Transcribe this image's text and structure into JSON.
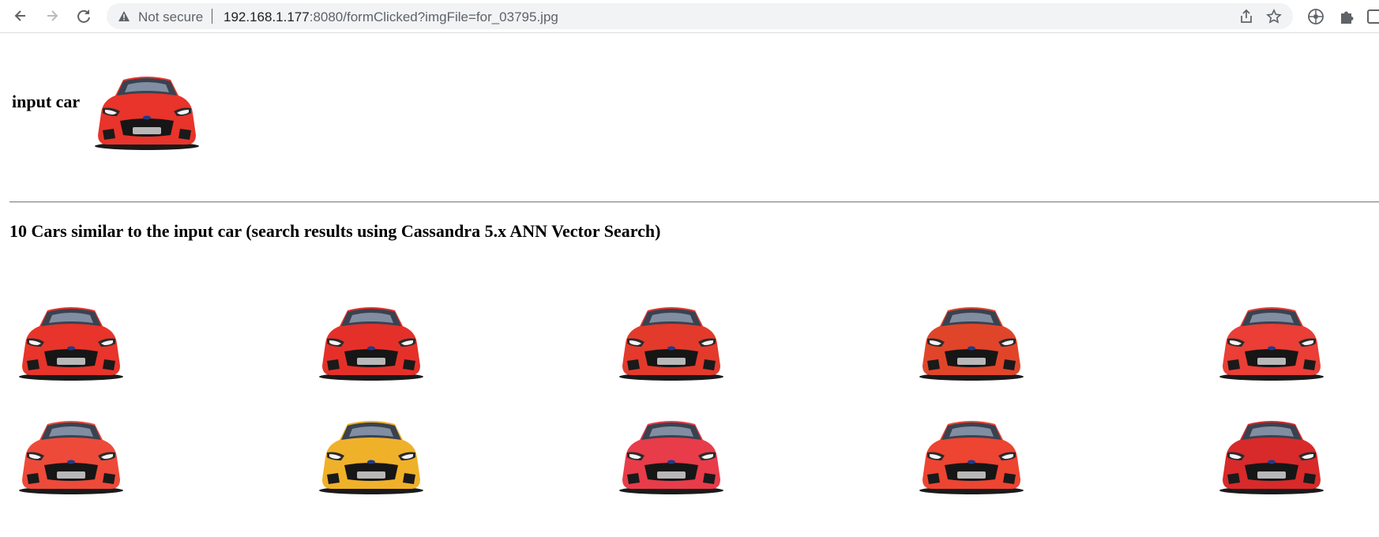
{
  "browser": {
    "security_label": "Not secure",
    "url_host": "192.168.1.177",
    "url_rest": ":8080/formClicked?imgFile=for_03795.jpg",
    "icons": [
      "back-icon",
      "forward-icon",
      "reload-icon",
      "warning-icon",
      "share-icon",
      "star-icon",
      "extension-puzzle-icon",
      "side-panel-icon"
    ]
  },
  "page": {
    "input_label": "input car",
    "results_title": "10 Cars similar to the input car (search results using Cassandra 5.x ANN Vector Search)"
  },
  "colors": {
    "car_red": "#e8342a",
    "car_orange_red": "#e84a2e",
    "car_yellow": "#f0b12a",
    "car_pink_red": "#e83c4a"
  },
  "results": [
    {
      "color": "#e8342a"
    },
    {
      "color": "#e5302a"
    },
    {
      "color": "#e33a2c"
    },
    {
      "color": "#e0452a"
    },
    {
      "color": "#ea3e36"
    },
    {
      "color": "#ee4a3a"
    },
    {
      "color": "#f0b12a"
    },
    {
      "color": "#e83c4a"
    },
    {
      "color": "#ee4432"
    },
    {
      "color": "#d82a2a"
    }
  ]
}
